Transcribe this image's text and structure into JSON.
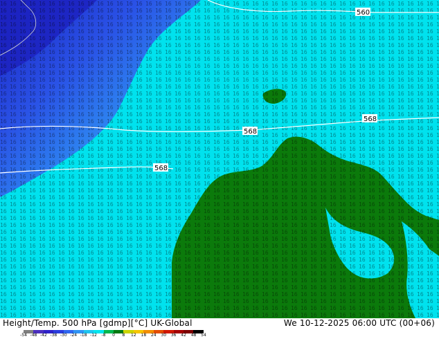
{
  "map": {
    "title_left": "Height/Temp. 500 hPa [gdmp][°C] UK-Global",
    "title_right": "We 10-12-2025 06:00 UTC (00+06)",
    "contour_labels": [
      "560",
      "568",
      "568",
      "568"
    ],
    "colorbar": {
      "labels": [
        "-54",
        "-48",
        "-42",
        "-38",
        "-30",
        "-24",
        "-18",
        "-12",
        "-8",
        "0",
        "8",
        "12",
        "18",
        "24",
        "30",
        "36",
        "42",
        "48",
        "54"
      ],
      "colors": [
        "#7f7f7f",
        "#4b2fbf",
        "#2e22c9",
        "#2a3cde",
        "#2f66f0",
        "#2f94f5",
        "#1fc4f0",
        "#00e5ef",
        "#00b94f",
        "#007a12",
        "#cbd400",
        "#f6c500",
        "#f28f00",
        "#e44d00",
        "#d11800",
        "#a60000",
        "#7d0000",
        "#000000"
      ]
    },
    "colors": {
      "ocean_cyan": "#00e2ee",
      "land_green": "#0b7a0b",
      "deep_blue": "#1d2fc9",
      "mid_blue": "#2f78ef",
      "contour_white": "#ffffff"
    }
  }
}
